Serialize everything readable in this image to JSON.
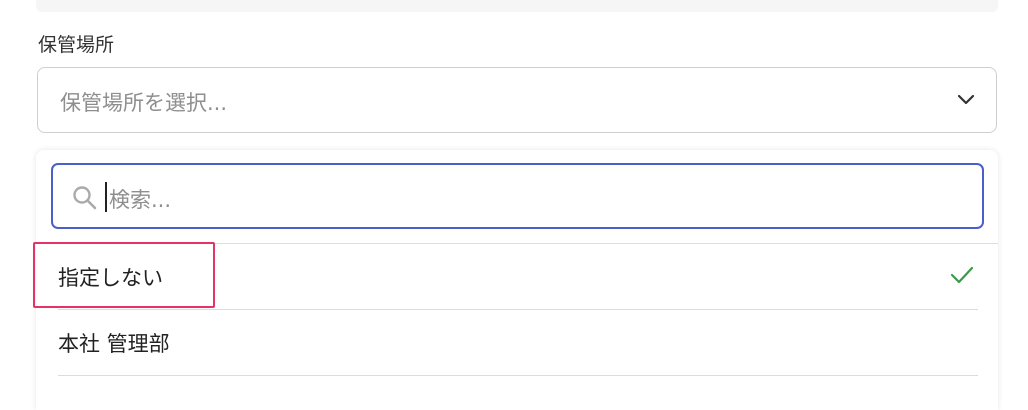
{
  "field": {
    "label": "保管場所",
    "placeholder": "保管場所を選択..."
  },
  "dropdown": {
    "search_placeholder": "検索...",
    "options": [
      {
        "label": "指定しない",
        "selected": true
      },
      {
        "label": "本社 管理部",
        "selected": false
      }
    ]
  },
  "colors": {
    "focus_border": "#4a60c8",
    "check": "#3a9a4a",
    "highlight": "#e3346a"
  }
}
